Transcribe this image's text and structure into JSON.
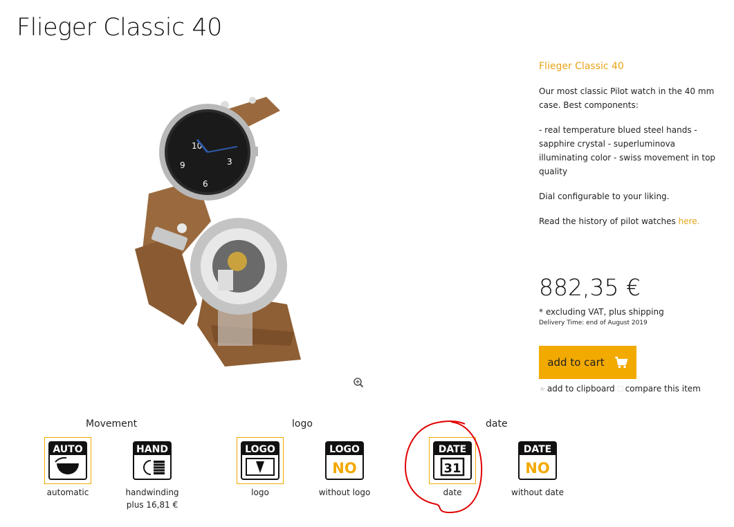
{
  "page": {
    "title": "Flieger Classic 40"
  },
  "product": {
    "name": "Flieger Classic 40",
    "desc1": "Our most classic Pilot watch in the 40 mm case. Best components:",
    "desc2": "- real temperature blued steel hands - sapphire crystal - superluminova illuminating color - swiss movement in top quality",
    "desc3": "Dial configurable to your liking.",
    "history_text": "Read the history of pilot watches ",
    "history_link": "here."
  },
  "price": {
    "amount": "882,35 €",
    "vat_note": "* excluding VAT, plus shipping",
    "delivery": "Delivery Time: end of August 2019"
  },
  "actions": {
    "add_to_cart": "add to cart",
    "clipboard": "add to clipboard",
    "compare": "compare this item"
  },
  "options": {
    "movement": {
      "label": "Movement",
      "items": [
        {
          "label": "automatic",
          "icon_text": "AUTO",
          "selected": true
        },
        {
          "label": "handwinding",
          "extra": "plus 16,81 €",
          "icon_text": "HAND",
          "selected": false
        }
      ]
    },
    "logo": {
      "label": "logo",
      "items": [
        {
          "label": "logo",
          "icon_text": "LOGO",
          "selected": true
        },
        {
          "label": "without logo",
          "icon_text": "LOGO",
          "icon_sub": "NO",
          "selected": false
        }
      ]
    },
    "date": {
      "label": "date",
      "items": [
        {
          "label": "date",
          "icon_text": "DATE",
          "icon_sub": "31",
          "selected": true
        },
        {
          "label": "without date",
          "icon_text": "DATE",
          "icon_sub": "NO",
          "selected": false
        }
      ]
    }
  },
  "colors": {
    "accent": "#f2a900",
    "link": "#e8a317",
    "annotation": "#e00000"
  },
  "icons": {
    "zoom": "zoom-in-icon",
    "cart": "cart-icon",
    "star": "star-icon",
    "compare": "compare-icon"
  }
}
